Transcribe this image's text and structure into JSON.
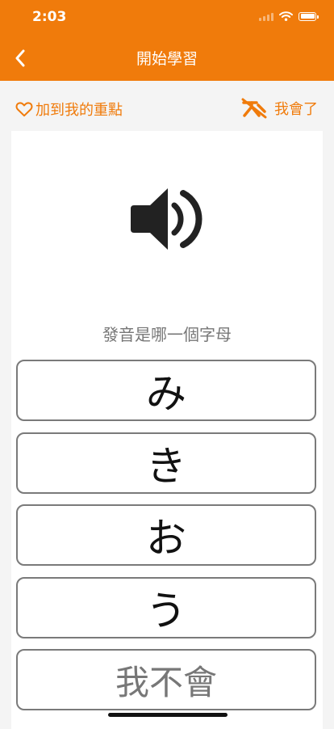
{
  "status_bar": {
    "time": "2:03"
  },
  "header": {
    "title": "開始學習"
  },
  "actions": {
    "favorite_label": "加到我的重點",
    "known_label": "我會了"
  },
  "question": {
    "prompt": "發音是哪一個字母"
  },
  "options": [
    "み",
    "き",
    "お",
    "う"
  ],
  "dont_know_label": "我不會",
  "colors": {
    "accent": "#f07b0b",
    "card": "#ffffff",
    "background": "#f4f4f4",
    "option_border": "#7a7a7a"
  },
  "icons": {
    "back": "chevron-left-icon",
    "favorite": "heart-outline-icon",
    "known": "mastered-icon",
    "audio": "speaker-icon",
    "status": [
      "signal-icon",
      "wifi-icon",
      "battery-icon"
    ]
  }
}
